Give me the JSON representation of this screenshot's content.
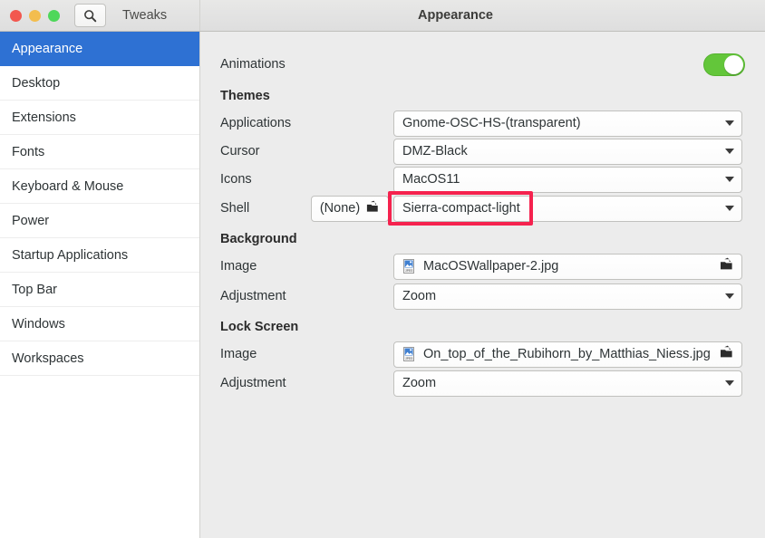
{
  "window": {
    "app_title": "Tweaks",
    "page_title": "Appearance",
    "search_icon": "search-icon",
    "traffic_lights": [
      {
        "name": "close-button",
        "color": "#f2574f"
      },
      {
        "name": "minimize-button",
        "color": "#f3bd4e"
      },
      {
        "name": "maximize-button",
        "color": "#4ed75a"
      }
    ]
  },
  "sidebar": {
    "items": [
      {
        "label": "Appearance",
        "selected": true
      },
      {
        "label": "Desktop",
        "selected": false
      },
      {
        "label": "Extensions",
        "selected": false
      },
      {
        "label": "Fonts",
        "selected": false
      },
      {
        "label": "Keyboard & Mouse",
        "selected": false
      },
      {
        "label": "Power",
        "selected": false
      },
      {
        "label": "Startup Applications",
        "selected": false
      },
      {
        "label": "Top Bar",
        "selected": false
      },
      {
        "label": "Windows",
        "selected": false
      },
      {
        "label": "Workspaces",
        "selected": false
      }
    ],
    "selected_color": "#2e71d3"
  },
  "main": {
    "animations": {
      "label": "Animations",
      "toggle_state": "on",
      "toggle_color": "#63c63a"
    },
    "themes": {
      "heading": "Themes",
      "applications": {
        "label": "Applications",
        "value": "Gnome-OSC-HS-(transparent)"
      },
      "cursor": {
        "label": "Cursor",
        "value": "DMZ-Black"
      },
      "icons": {
        "label": "Icons",
        "value": "MacOS11"
      },
      "shell": {
        "label": "Shell",
        "none_button": "(None)",
        "value": "Sierra-compact-light",
        "highlighted": true,
        "highlight_color": "#f5224e"
      }
    },
    "background": {
      "heading": "Background",
      "image": {
        "label": "Image",
        "value": "MacOSWallpaper-2.jpg"
      },
      "adjustment": {
        "label": "Adjustment",
        "value": "Zoom"
      }
    },
    "lock_screen": {
      "heading": "Lock Screen",
      "image": {
        "label": "Image",
        "value": "On_top_of_the_Rubihorn_by_Matthias_Niess.jpg"
      },
      "adjustment": {
        "label": "Adjustment",
        "value": "Zoom"
      }
    }
  }
}
